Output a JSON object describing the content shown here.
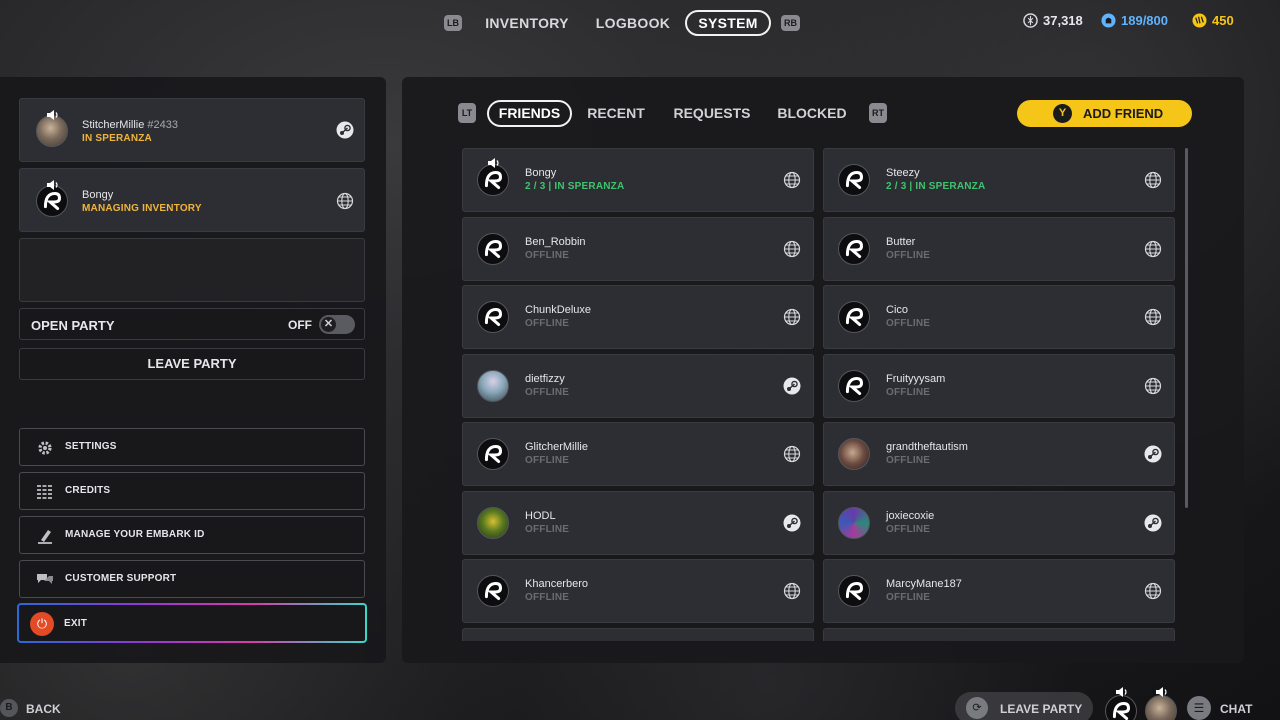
{
  "nav": {
    "lb": "LB",
    "rb": "RB",
    "tabs": [
      "INVENTORY",
      "LOGBOOK",
      "SYSTEM"
    ],
    "active_tab": "SYSTEM"
  },
  "currencies": [
    {
      "icon": "coin-icon",
      "value": "37,318",
      "color": "#e6e6ea"
    },
    {
      "icon": "storage-icon",
      "value": "189/800",
      "color": "#5fb3ff"
    },
    {
      "icon": "premium-coin-icon",
      "value": "450",
      "color": "#f5c518"
    }
  ],
  "party": {
    "members": [
      {
        "name": "StitcherMillie",
        "tag": "#2433",
        "status": "IN SPERANZA",
        "platform": "steam-icon"
      },
      {
        "name": "Bongy",
        "tag": "",
        "status": "MANAGING INVENTORY",
        "platform": "globe-icon"
      }
    ],
    "open_party_label": "OPEN PARTY",
    "open_party_value": "OFF",
    "toggle_glyph": "✕",
    "leave_party_label": "LEAVE PARTY"
  },
  "menu": {
    "settings": "SETTINGS",
    "credits": "CREDITS",
    "embark_id": "MANAGE YOUR EMBARK ID",
    "support": "CUSTOMER SUPPORT",
    "exit": "EXIT"
  },
  "friends_tabs": {
    "lt": "LT",
    "rt": "RT",
    "tabs": [
      "FRIENDS",
      "RECENT",
      "REQUESTS",
      "BLOCKED"
    ],
    "active_tab": "FRIENDS",
    "add_friend_button": "Y",
    "add_friend_label": "ADD FRIEND"
  },
  "friends": [
    {
      "name": "Bongy",
      "status": "2 / 3 | IN SPERANZA",
      "online": true,
      "platform": "globe-icon",
      "avatar": "default",
      "speaking": true
    },
    {
      "name": "Steezy",
      "status": "2 / 3 | IN SPERANZA",
      "online": true,
      "platform": "globe-icon",
      "avatar": "default",
      "speaking": false
    },
    {
      "name": "Ben_Robbin",
      "status": "OFFLINE",
      "online": false,
      "platform": "globe-icon",
      "avatar": "default"
    },
    {
      "name": "Butter",
      "status": "OFFLINE",
      "online": false,
      "platform": "globe-icon",
      "avatar": "default"
    },
    {
      "name": "ChunkDeluxe",
      "status": "OFFLINE",
      "online": false,
      "platform": "globe-icon",
      "avatar": "default"
    },
    {
      "name": "Cico",
      "status": "OFFLINE",
      "online": false,
      "platform": "globe-icon",
      "avatar": "default"
    },
    {
      "name": "dietfizzy",
      "status": "OFFLINE",
      "online": false,
      "platform": "steam-icon",
      "avatar": "photo2"
    },
    {
      "name": "Fruityyysam",
      "status": "OFFLINE",
      "online": false,
      "platform": "globe-icon",
      "avatar": "default"
    },
    {
      "name": "GlitcherMillie",
      "status": "OFFLINE",
      "online": false,
      "platform": "globe-icon",
      "avatar": "default"
    },
    {
      "name": "grandtheftautism",
      "status": "OFFLINE",
      "online": false,
      "platform": "steam-icon",
      "avatar": "photo4"
    },
    {
      "name": "HODL",
      "status": "OFFLINE",
      "online": false,
      "platform": "steam-icon",
      "avatar": "photo3"
    },
    {
      "name": "joxiecoxie",
      "status": "OFFLINE",
      "online": false,
      "platform": "steam-icon",
      "avatar": "photo5"
    },
    {
      "name": "Khancerbero",
      "status": "OFFLINE",
      "online": false,
      "platform": "globe-icon",
      "avatar": "default"
    },
    {
      "name": "MarcyMane187",
      "status": "OFFLINE",
      "online": false,
      "platform": "globe-icon",
      "avatar": "default"
    }
  ],
  "bottom": {
    "back_key": "B",
    "back_label": "BACK",
    "leave_party_label": "LEAVE PARTY",
    "chat_label": "CHAT"
  },
  "colors": {
    "online": "#3ec46d",
    "status_accent": "#f0b43a",
    "add_friend": "#f5c518",
    "exit": "#e24b25"
  }
}
